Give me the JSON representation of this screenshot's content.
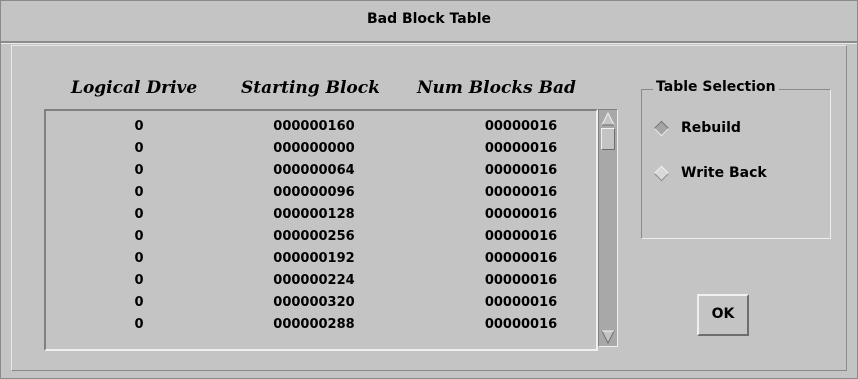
{
  "window": {
    "title": "Bad Block Table"
  },
  "table": {
    "headers": {
      "logical": "Logical Drive",
      "start": "Starting Block",
      "num": "Num Blocks Bad"
    },
    "rows": [
      {
        "logical": "0",
        "start": "000000160",
        "num": "00000016"
      },
      {
        "logical": "0",
        "start": "000000000",
        "num": "00000016"
      },
      {
        "logical": "0",
        "start": "000000064",
        "num": "00000016"
      },
      {
        "logical": "0",
        "start": "000000096",
        "num": "00000016"
      },
      {
        "logical": "0",
        "start": "000000128",
        "num": "00000016"
      },
      {
        "logical": "0",
        "start": "000000256",
        "num": "00000016"
      },
      {
        "logical": "0",
        "start": "000000192",
        "num": "00000016"
      },
      {
        "logical": "0",
        "start": "000000224",
        "num": "00000016"
      },
      {
        "logical": "0",
        "start": "000000320",
        "num": "00000016"
      },
      {
        "logical": "0",
        "start": "000000288",
        "num": "00000016"
      }
    ]
  },
  "table_selection": {
    "title": "Table Selection",
    "options": [
      {
        "label": "Rebuild",
        "selected": true
      },
      {
        "label": "Write Back",
        "selected": false
      }
    ]
  },
  "buttons": {
    "ok": "OK"
  },
  "icons": {
    "scroll_up": "arrow-up-icon",
    "scroll_down": "arrow-down-icon",
    "radio": "diamond-radio-icon"
  }
}
